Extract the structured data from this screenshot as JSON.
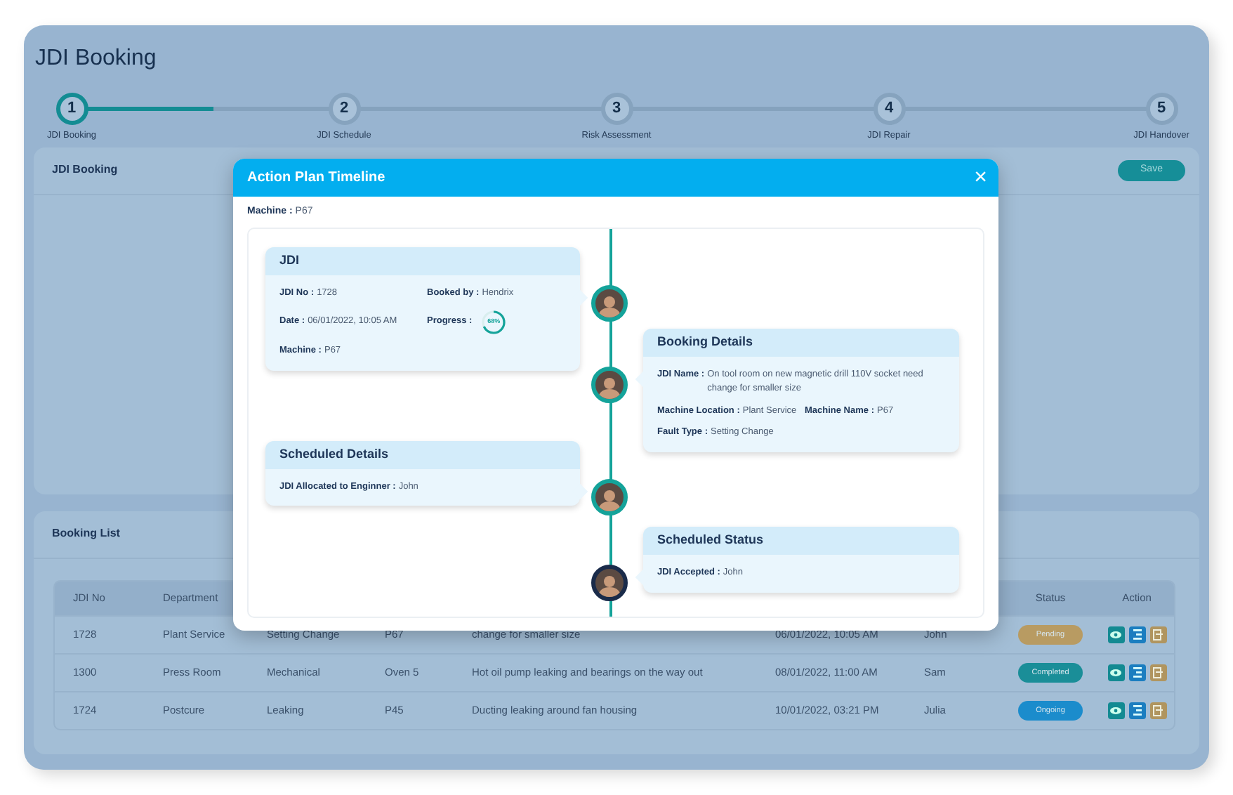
{
  "page_title": "JDI Booking",
  "stepper": {
    "level": 0.13,
    "steps": [
      {
        "number": "1",
        "label": "JDI Booking",
        "selected": true
      },
      {
        "number": "2",
        "label": "JDI Schedule",
        "selected": false
      },
      {
        "number": "3",
        "label": "Risk Assessment",
        "selected": false
      },
      {
        "number": "4",
        "label": "JDI Repair",
        "selected": false
      },
      {
        "number": "5",
        "label": "JDI Handover",
        "selected": false
      }
    ]
  },
  "booking_panel": {
    "title": "JDI Booking",
    "save_button": "Save"
  },
  "booking_list": {
    "title": "Booking List",
    "columns_left": [
      "JDI No",
      "Department"
    ],
    "columns_right": [
      "Status",
      "Action"
    ],
    "rows": [
      {
        "cells": [
          "1728",
          "Plant Service",
          "Setting Change",
          "P67",
          "change for smaller size",
          "06/01/2022, 10:05 AM",
          "John"
        ],
        "status": {
          "label": "Pending",
          "color": "#b89b62"
        }
      },
      {
        "cells": [
          "1300",
          "Press Room",
          "Mechanical",
          "Oven 5",
          "Hot oil pump leaking and bearings on the way out",
          "08/01/2022, 11:00 AM",
          "Sam"
        ],
        "status": {
          "label": "Completed",
          "color": "#1a8e98"
        }
      },
      {
        "cells": [
          "1724",
          "Postcure",
          "Leaking",
          "P45",
          "Ducting leaking around fan housing",
          "10/01/2022, 03:21 PM",
          "Julia"
        ],
        "status": {
          "label": "Ongoing",
          "color": "#1b8ccc"
        }
      }
    ]
  },
  "modal": {
    "title": "Action Plan Timeline",
    "close": "×",
    "machine": {
      "label": "Machine :",
      "value": "P67"
    },
    "timeline": [
      {
        "title": "JDI",
        "color": "#14a39a",
        "rows": [
          [
            {
              "label": "JDI No :",
              "value": "1728"
            },
            {
              "label": "Booked by :",
              "value": "Hendrix"
            }
          ],
          [
            {
              "label": "Date :",
              "value": "06/01/2022, 10:05 AM"
            },
            {
              "label": "Progress :",
              "kind": "progress",
              "level": 0.68,
              "reading": "68%"
            }
          ],
          [
            {
              "label": "Machine :",
              "value": "P67"
            }
          ]
        ]
      },
      {
        "title": "Booking Details",
        "color": "#14a39a",
        "rows": [
          [
            {
              "label": "JDI Name :",
              "value": "On tool room on new magnetic drill 110V socket need change for smaller size"
            }
          ],
          [
            {
              "label": "Machine Location :",
              "value": "Plant Service"
            },
            {
              "label": "Machine Name :",
              "value": "P67"
            }
          ],
          [
            {
              "label": "Fault Type :",
              "value": "Setting Change"
            }
          ]
        ]
      },
      {
        "title": "Scheduled Details",
        "color": "#14a39a",
        "rows": [
          [
            {
              "label": "JDI Allocated to Enginner :",
              "value": "John"
            }
          ]
        ]
      },
      {
        "title": "Scheduled Status",
        "color": "#1a2b4a",
        "rows": [
          [
            {
              "label": "JDI Accepted :",
              "value": "John"
            }
          ]
        ]
      }
    ]
  }
}
